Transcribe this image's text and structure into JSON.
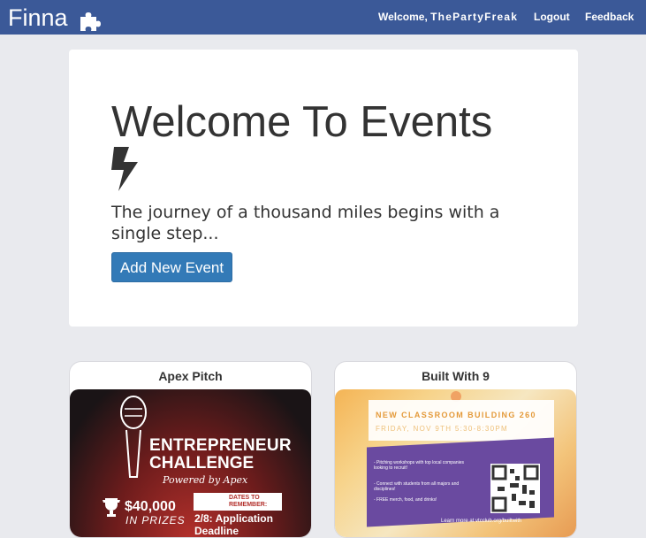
{
  "navbar": {
    "brand": "Finna",
    "brand_icon": "puzzle-piece-icon",
    "welcome_prefix": "Welcome, ",
    "username": "ThePartyFreak",
    "logout": "Logout",
    "feedback": "Feedback",
    "bg_color": "#3b5998"
  },
  "hero": {
    "title": "Welcome To Events",
    "icon": "bolt-icon",
    "tagline": "The journey of a thousand miles begins with a single step...",
    "button": "Add New Event",
    "button_color": "#337ab7"
  },
  "events": [
    {
      "title": "Apex Pitch",
      "poster": {
        "heading_line1": "ENTREPRENEUR",
        "heading_line2": "CHALLENGE",
        "sub": "Powered by Apex",
        "prize": "$40,000",
        "prize_sub": "IN PRIZES",
        "dates_label": "DATES TO REMEMBER:",
        "deadline": "2/8: Application Deadline"
      }
    },
    {
      "title": "Built With 9",
      "poster": {
        "heading": "NEW CLASSROOM BUILDING 260",
        "subheading": "FRIDAY, NOV 9TH 5:30-8:30PM",
        "bullets": [
          "- Pitching workshops with top local companies looking to recruit!",
          "- Connect with students from all majors and disciplines!",
          "- FREE merch, food, and drinks!"
        ],
        "learn_more": "Learn more at vtcclub.org/builtwith"
      }
    }
  ]
}
